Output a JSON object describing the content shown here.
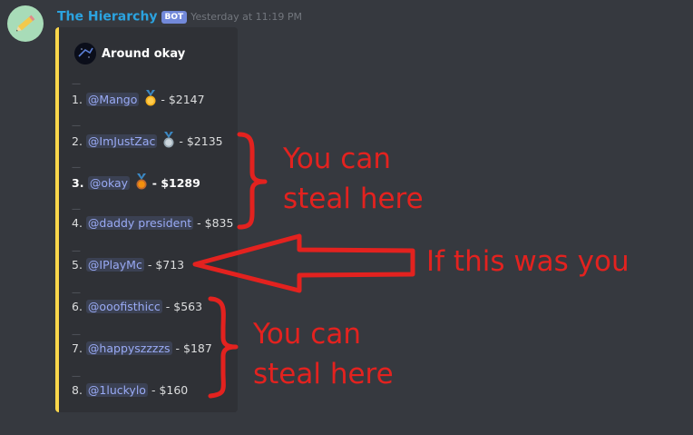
{
  "message": {
    "author": "The Hierarchy",
    "bot_tag": "BOT",
    "timestamp": "Yesterday at 11:19 PM"
  },
  "embed": {
    "author_name": "Around okay",
    "accent_color": "#fbd74b",
    "divider": "—",
    "entries": [
      {
        "rank": "1.",
        "user": "@Mango",
        "sep": " - ",
        "amount": "$2147",
        "medal": "gold-medal-icon"
      },
      {
        "rank": "2.",
        "user": "@ImJustZac",
        "sep": " - ",
        "amount": "$2135",
        "medal": "silver-medal-icon"
      },
      {
        "rank": "3.",
        "user": "@okay",
        "sep": " - ",
        "amount": "$1289",
        "medal": "bronze-medal-icon"
      },
      {
        "rank": "4.",
        "user": "@daddy president",
        "sep": " - ",
        "amount": "$835"
      },
      {
        "rank": "5.",
        "user": "@IPlayMc",
        "sep": " - ",
        "amount": "$713"
      },
      {
        "rank": "6.",
        "user": "@ooofisthicc",
        "sep": " - ",
        "amount": "$563"
      },
      {
        "rank": "7.",
        "user": "@happyszzzzs",
        "sep": " - ",
        "amount": "$187"
      },
      {
        "rank": "8.",
        "user": "@1luckylo",
        "sep": " - ",
        "amount": "$160"
      }
    ]
  },
  "annotations": {
    "upper_line1": "You can",
    "upper_line2": "steal here",
    "arrow_text": "If this was you",
    "lower_line1": "You can",
    "lower_line2": "steal here",
    "color": "#e3221f"
  }
}
